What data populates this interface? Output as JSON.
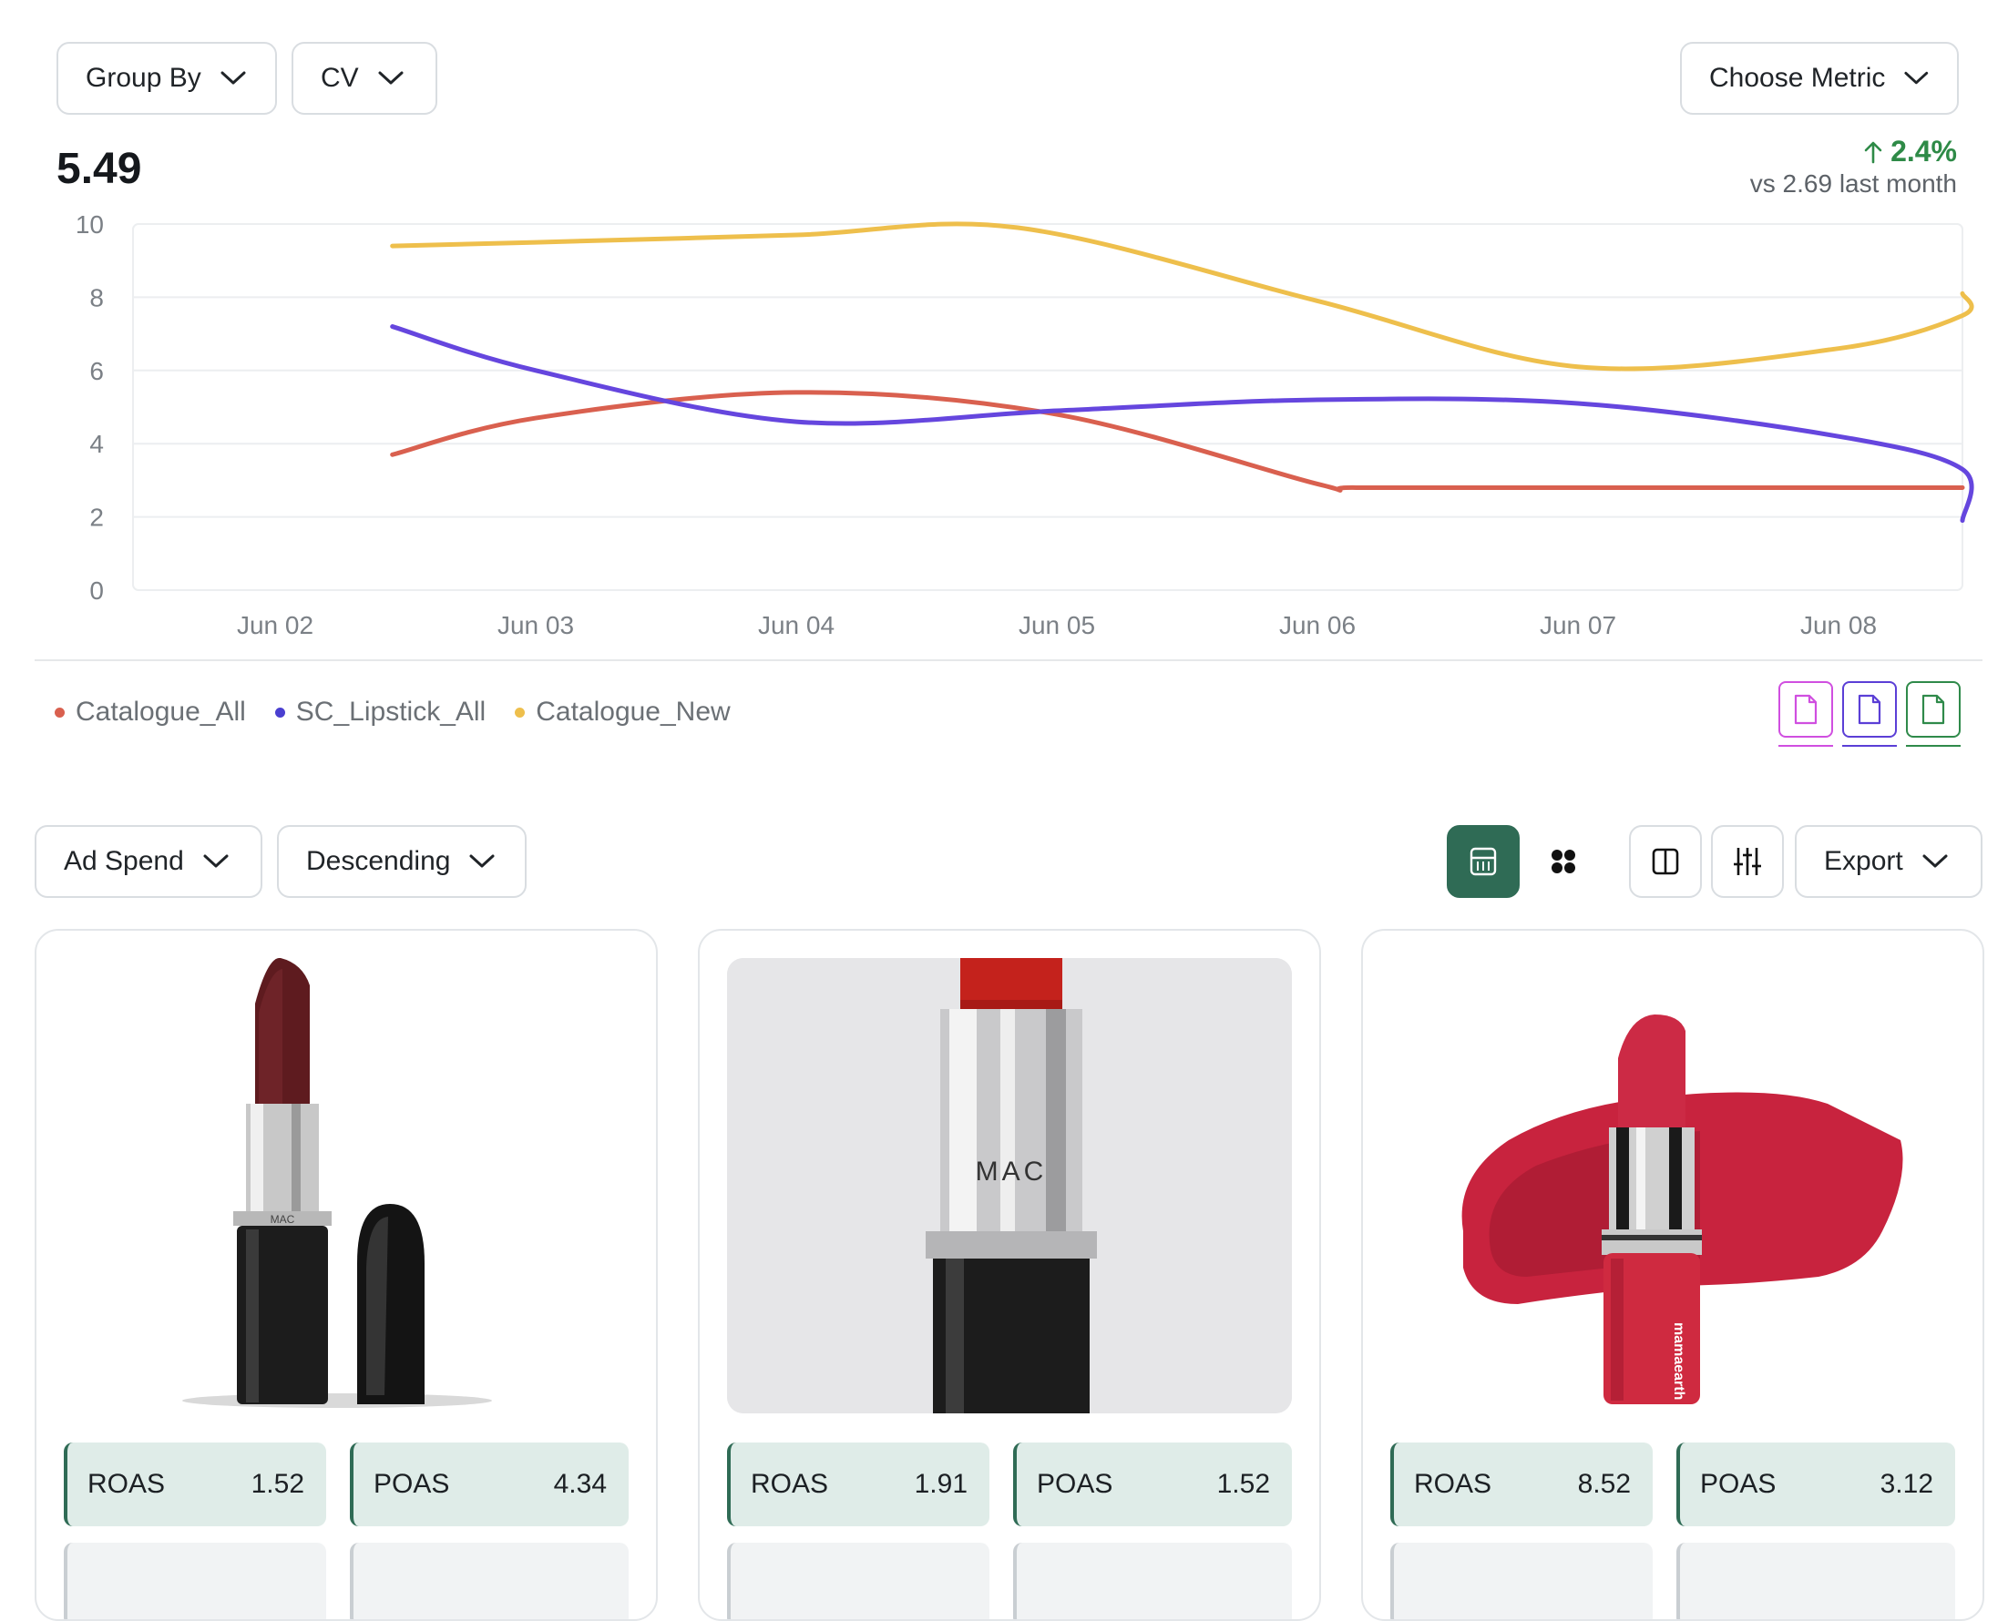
{
  "toolbar_top": {
    "group_by": "Group By",
    "cv": "CV",
    "choose_metric": "Choose Metric"
  },
  "headline": {
    "value": "5.49",
    "delta": "2.4%",
    "compare": "vs 2.69 last month",
    "delta_color": "#2e8a47"
  },
  "chart_data": {
    "type": "line",
    "x": [
      "Jun 02",
      "Jun 03",
      "Jun 04",
      "Jun 05",
      "Jun 06",
      "Jun 07",
      "Jun 08"
    ],
    "ylim": [
      0,
      10
    ],
    "yticks": [
      "0",
      "2",
      "4",
      "6",
      "8",
      "10"
    ],
    "series": [
      {
        "name": "Catalogue_All",
        "color": "#d9604f",
        "x": [
          1.45,
          2.0,
          3.0,
          4.0,
          5.0,
          5.15,
          6.0,
          7.0,
          8.5
        ],
        "values": [
          3.7,
          4.7,
          5.4,
          4.8,
          2.9,
          2.8,
          2.8,
          2.8,
          2.8
        ]
      },
      {
        "name": "SC_Lipstick_All",
        "color": "#6546de",
        "x": [
          1.45,
          2.0,
          3.0,
          4.0,
          5.0,
          6.0,
          7.0,
          7.5,
          8.5
        ],
        "values": [
          7.2,
          6.0,
          4.6,
          4.9,
          5.2,
          5.1,
          4.2,
          3.3,
          1.9
        ]
      },
      {
        "name": "Catalogue_New",
        "color": "#eebf4c",
        "x": [
          1.45,
          2.0,
          3.0,
          3.85,
          5.0,
          6.0,
          7.0,
          8.0,
          8.5
        ],
        "values": [
          9.4,
          9.5,
          9.7,
          9.9,
          7.9,
          6.1,
          6.6,
          7.5,
          8.1
        ]
      }
    ]
  },
  "export_icons": [
    {
      "name": "file-pink-icon",
      "color": "#d04fe0"
    },
    {
      "name": "file-purple-icon",
      "color": "#5b3fd6"
    },
    {
      "name": "file-green-icon",
      "color": "#2f8a4a"
    }
  ],
  "toolbar_bottom": {
    "sort_metric": "Ad Spend",
    "sort_order": "Descending",
    "export": "Export",
    "accent": "#2f6b55"
  },
  "cards": [
    {
      "metrics": [
        {
          "label": "ROAS",
          "value": "1.52"
        },
        {
          "label": "POAS",
          "value": "4.34"
        }
      ]
    },
    {
      "metrics": [
        {
          "label": "ROAS",
          "value": "1.91"
        },
        {
          "label": "POAS",
          "value": "1.52"
        }
      ]
    },
    {
      "metrics": [
        {
          "label": "ROAS",
          "value": "8.52"
        },
        {
          "label": "POAS",
          "value": "3.12"
        }
      ]
    }
  ]
}
